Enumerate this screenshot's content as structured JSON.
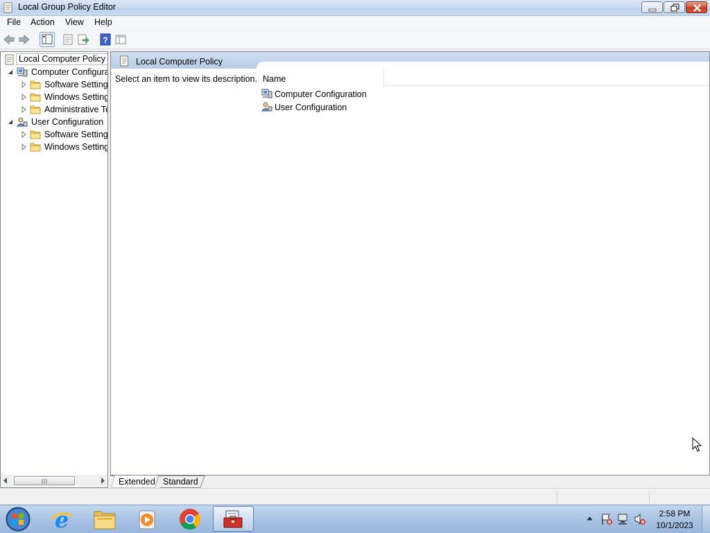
{
  "window": {
    "title": "Local Group Policy Editor"
  },
  "menu": [
    "File",
    "Action",
    "View",
    "Help"
  ],
  "tree": {
    "root": "Local Computer Policy",
    "items": [
      {
        "label": "Computer Configura",
        "level": 1,
        "expanded": true,
        "icon": "computer-config-icon"
      },
      {
        "label": "Software Settings",
        "level": 2,
        "icon": "folder-icon"
      },
      {
        "label": "Windows Setting",
        "level": 2,
        "icon": "folder-icon"
      },
      {
        "label": "Administrative Te",
        "level": 2,
        "icon": "folder-icon"
      },
      {
        "label": "User Configuration",
        "level": 1,
        "expanded": true,
        "icon": "user-config-icon"
      },
      {
        "label": "Software Settings",
        "level": 2,
        "icon": "folder-icon"
      },
      {
        "label": "Windows Setting",
        "level": 2,
        "icon": "folder-icon"
      }
    ]
  },
  "main": {
    "header": "Local Computer Policy",
    "description": "Select an item to view its description.",
    "column": "Name",
    "items": [
      {
        "label": "Computer Configuration",
        "icon": "computer-config-icon"
      },
      {
        "label": "User Configuration",
        "icon": "user-config-icon"
      }
    ]
  },
  "tabs": {
    "extended": "Extended",
    "standard": "Standard",
    "active": "Extended"
  },
  "clock": {
    "time": "2:58 PM",
    "date": "10/1/2023"
  },
  "colors": {
    "titlebar": "#c9dbef",
    "close_button": "#c43a1f",
    "taskbar": "#a9c3e3",
    "header": "#b7cde6"
  }
}
